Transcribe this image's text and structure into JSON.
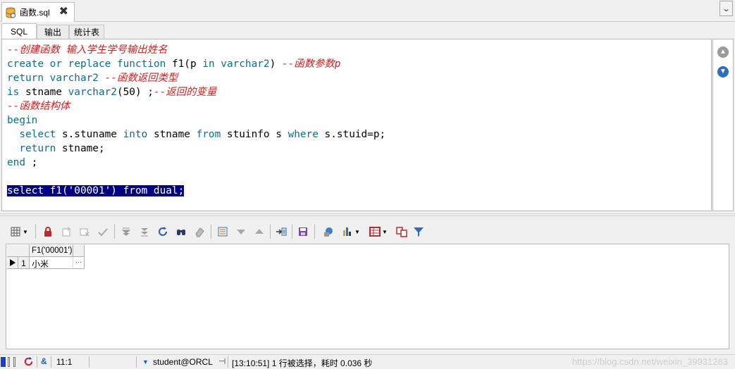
{
  "document_tab": {
    "title": "函数.sql",
    "close": "✖"
  },
  "subtabs": [
    "SQL",
    "输出",
    "统计表"
  ],
  "editor": {
    "lines": [
      [
        {
          "t": "cmt",
          "v": "--创建函数 输入学生学号输出姓名"
        }
      ],
      [
        {
          "t": "kw",
          "v": "create"
        },
        {
          "t": "",
          "v": " "
        },
        {
          "t": "kw",
          "v": "or"
        },
        {
          "t": "",
          "v": " "
        },
        {
          "t": "kw",
          "v": "replace"
        },
        {
          "t": "",
          "v": " "
        },
        {
          "t": "kw",
          "v": "function"
        },
        {
          "t": "",
          "v": " f1(p "
        },
        {
          "t": "kw",
          "v": "in"
        },
        {
          "t": "",
          "v": " "
        },
        {
          "t": "kw",
          "v": "varchar2"
        },
        {
          "t": "",
          "v": ") "
        },
        {
          "t": "cmt",
          "v": "--函数参数p"
        }
      ],
      [
        {
          "t": "kw",
          "v": "return"
        },
        {
          "t": "",
          "v": " "
        },
        {
          "t": "kw",
          "v": "varchar2"
        },
        {
          "t": "",
          "v": " "
        },
        {
          "t": "cmt",
          "v": "--函数返回类型"
        }
      ],
      [
        {
          "t": "kw",
          "v": "is"
        },
        {
          "t": "",
          "v": " stname "
        },
        {
          "t": "kw",
          "v": "varchar2"
        },
        {
          "t": "",
          "v": "(50) ;"
        },
        {
          "t": "cmt",
          "v": "--返回的变量"
        }
      ],
      [
        {
          "t": "cmt",
          "v": "--函数结构体"
        }
      ],
      [
        {
          "t": "kw",
          "v": "begin"
        }
      ],
      [
        {
          "t": "",
          "v": "  "
        },
        {
          "t": "kw",
          "v": "select"
        },
        {
          "t": "",
          "v": " s.stuname "
        },
        {
          "t": "kw",
          "v": "into"
        },
        {
          "t": "",
          "v": " stname "
        },
        {
          "t": "kw",
          "v": "from"
        },
        {
          "t": "",
          "v": " stuinfo s "
        },
        {
          "t": "kw",
          "v": "where"
        },
        {
          "t": "",
          "v": " s.stuid=p;"
        }
      ],
      [
        {
          "t": "",
          "v": "  "
        },
        {
          "t": "kw",
          "v": "return"
        },
        {
          "t": "",
          "v": " stname;"
        }
      ],
      [
        {
          "t": "kw",
          "v": "end"
        },
        {
          "t": "",
          "v": " ;"
        }
      ],
      [],
      [
        {
          "t": "sel",
          "v": "select f1('00001') from dual;"
        }
      ]
    ]
  },
  "results": {
    "columns": [
      "F1('00001')"
    ],
    "rows": [
      {
        "num": "1",
        "values": [
          "小米"
        ],
        "more": "···"
      }
    ]
  },
  "statusbar": {
    "position": "11:1",
    "connection": "student@ORCL",
    "message": "[13:10:51] 1 行被选择，耗时 0.036 秒"
  },
  "watermark": "https://blog.csdn.net/weixin_39931283",
  "colors": {
    "keyword": "#0d6e8f",
    "comment": "#d81c1c",
    "selection": "#000080"
  }
}
